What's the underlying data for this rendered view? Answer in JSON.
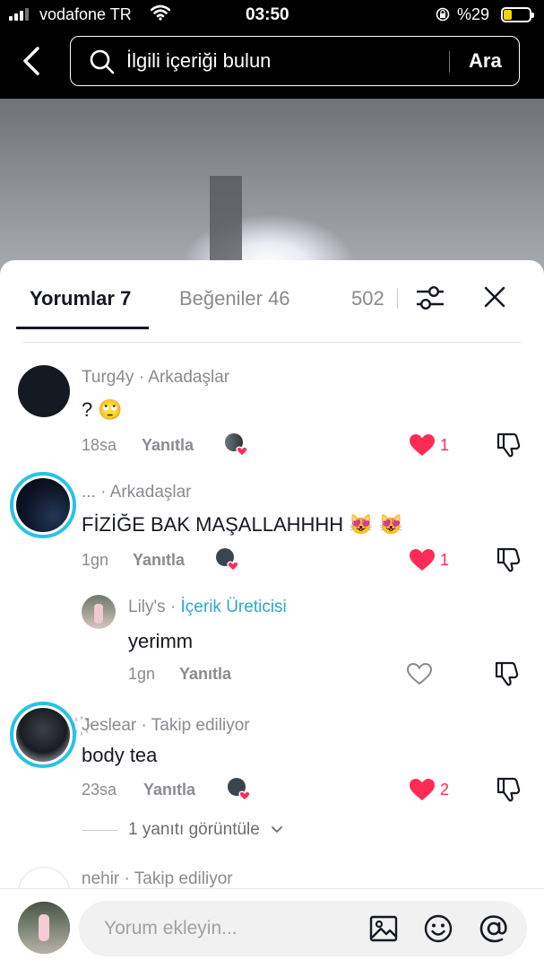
{
  "status_bar": {
    "carrier": "vodafone TR",
    "time": "03:50",
    "battery": "%29",
    "battery_level": 0.29
  },
  "search": {
    "placeholder": "İlgili içeriği bulun",
    "button": "Ara"
  },
  "tabs": {
    "comments": "Yorumlar 7",
    "likes": "Beğeniler 46",
    "third": "502"
  },
  "comments": [
    {
      "name": "Turg4y",
      "relation": " · Arkadaşlar",
      "text": "? ",
      "emoji": "🙄",
      "time": "18sa",
      "reply": "Yanıtla",
      "likes": "1",
      "liked": true
    },
    {
      "name": "...",
      "relation": " · Arkadaşlar",
      "text": "FİZİĞE BAK MAŞALLAHHHH ",
      "emoji": "😻 😻",
      "time": "1gn",
      "reply": "Yanıtla",
      "likes": "1",
      "liked": true,
      "replies": [
        {
          "name": "Lily's",
          "relation": " · ",
          "badge": "İçerik Üreticisi",
          "text": "yerimm",
          "time": "1gn",
          "reply": "Yanıtla",
          "liked": false
        }
      ]
    },
    {
      "name": "꙰Jeslear",
      "relation": " · Takip ediliyor",
      "text": "body tea",
      "time": "23sa",
      "reply": "Yanıtla",
      "likes": "2",
      "liked": true,
      "view_replies": "1 yanıtı görüntüle"
    },
    {
      "name": "nehir",
      "relation": " · Takip ediliyor"
    }
  ],
  "composer": {
    "placeholder": "Yorum ekleyin..."
  },
  "colors": {
    "like_red": "#fe2c55",
    "creator_blue": "#2ba8c6",
    "story_ring": "#27c3e6"
  }
}
